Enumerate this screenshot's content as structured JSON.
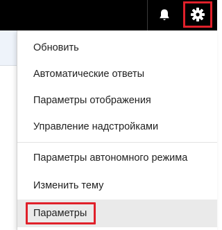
{
  "header": {
    "notifications_icon": "bell-icon",
    "settings_icon": "gear-icon",
    "highlight_color": "#e0202a"
  },
  "menu": {
    "items": [
      {
        "label": "Обновить"
      },
      {
        "label": "Автоматические ответы"
      },
      {
        "label": "Параметры отображения"
      },
      {
        "label": "Управление надстройками"
      },
      {
        "label": "Параметры автономного режима"
      },
      {
        "label": "Изменить тему"
      },
      {
        "label": "Параметры"
      }
    ]
  }
}
